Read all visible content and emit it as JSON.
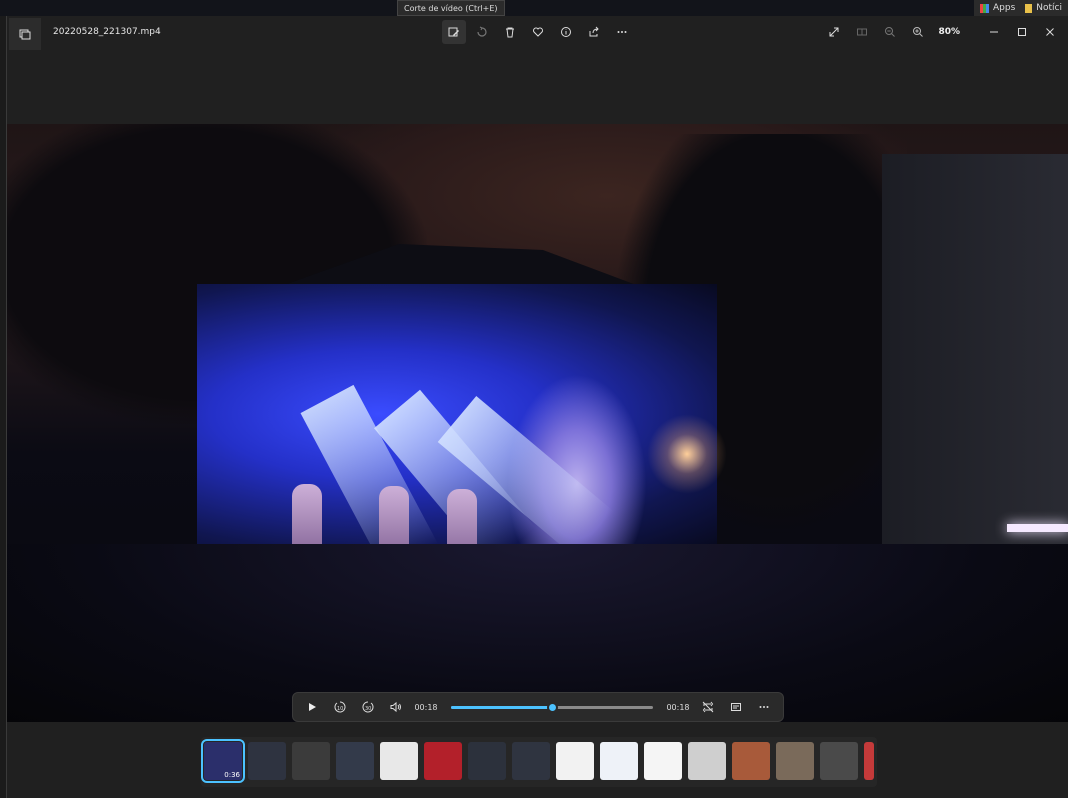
{
  "bookmarks": [
    {
      "label": "Apps",
      "icon": "apps-grid-icon"
    },
    {
      "label": "Notíci",
      "icon": "bookmark-note-icon"
    }
  ],
  "window": {
    "filename": "20220528_221307.mp4",
    "tooltip": "Corte de vídeo (Ctrl+E)",
    "zoom": "80%",
    "toolbar_icons": [
      "video-trim-icon",
      "rotate-icon",
      "delete-icon",
      "favorite-heart-icon",
      "info-icon",
      "share-icon",
      "more-icon"
    ],
    "right_icons": [
      "fullscreen-expand-icon",
      "compare-icon",
      "zoom-out-icon",
      "zoom-in-icon"
    ],
    "window_controls": [
      "minimize-icon",
      "maximize-icon",
      "close-icon"
    ]
  },
  "player": {
    "current_time": "00:18",
    "duration": "00:18",
    "progress": 0.5,
    "buttons": [
      "play-icon",
      "skip-back-10-icon",
      "skip-forward-30-icon",
      "volume-icon",
      "repeat-off-icon",
      "captions-icon",
      "more-icon"
    ]
  },
  "filmstrip": {
    "selected_duration": "0:36",
    "thumbs": [
      {
        "color": "#2b2f6b"
      },
      {
        "color": "#2e3340"
      },
      {
        "color": "#3b3b3b"
      },
      {
        "color": "#333a4a"
      },
      {
        "color": "#e8e8e8"
      },
      {
        "color": "#b3202a"
      },
      {
        "color": "#2c313c"
      },
      {
        "color": "#2f3440"
      },
      {
        "color": "#f2f2f2"
      },
      {
        "color": "#eef2f8"
      },
      {
        "color": "#f5f5f5"
      },
      {
        "color": "#cfcfcf"
      },
      {
        "color": "#a85a3a"
      },
      {
        "color": "#7a6a5a"
      },
      {
        "color": "#4a4a4a"
      },
      {
        "color": "#c43a3a"
      }
    ]
  },
  "colors": {
    "accent": "#4cc2ff",
    "background": "#202020"
  }
}
